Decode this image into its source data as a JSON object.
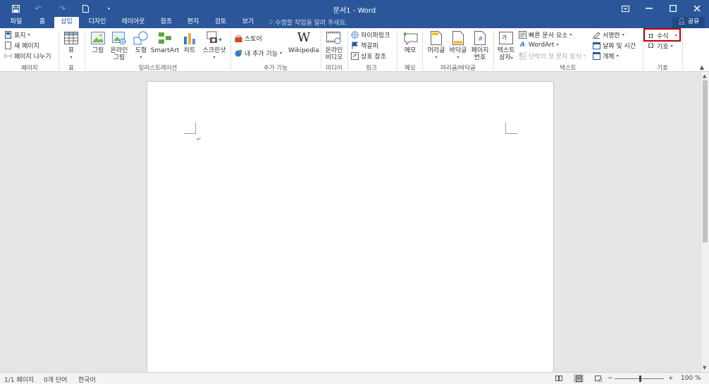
{
  "titlebar": {
    "title": "문서1 - Word",
    "qat": [
      {
        "name": "save-icon",
        "glyph": "💾"
      },
      {
        "name": "undo-icon",
        "glyph": "↶"
      },
      {
        "name": "redo-icon",
        "glyph": "↷"
      },
      {
        "name": "new-document-icon",
        "glyph": "🗋"
      },
      {
        "name": "customize-qat-icon",
        "glyph": "▾"
      }
    ],
    "controls": {
      "ribbon_options": "▭",
      "minimize": "—",
      "maximize": "☐",
      "close": "✕"
    }
  },
  "tabs": [
    {
      "label": "파일"
    },
    {
      "label": "홈"
    },
    {
      "label": "삽입"
    },
    {
      "label": "디자인"
    },
    {
      "label": "레이아웃"
    },
    {
      "label": "참조"
    },
    {
      "label": "편지"
    },
    {
      "label": "검토"
    },
    {
      "label": "보기"
    }
  ],
  "active_tab": "삽입",
  "tell_me": "수행할 작업을 알려 주세요.",
  "share_label": "공유",
  "ribbon": {
    "pages": {
      "label": "페이지",
      "cover": "표지",
      "blank": "새 페이지",
      "break": "페이지 나누기"
    },
    "table": {
      "label": "표",
      "button": "표"
    },
    "illustrations": {
      "label": "일러스트레이션",
      "picture": "그림",
      "online_picture": [
        "온라인",
        "그림"
      ],
      "shapes": "도형",
      "smartart": "SmartArt",
      "chart": "차트",
      "screenshot": "스크린샷"
    },
    "addins": {
      "label": "추가 기능",
      "store": "스토어",
      "my_addins": "내 추가 기능",
      "wikipedia": "Wikipedia"
    },
    "media": {
      "label": "미디어",
      "online_video": [
        "온라인",
        "비디오"
      ]
    },
    "links": {
      "label": "링크",
      "hyperlink": "하이퍼링크",
      "bookmark": "책갈피",
      "cross_ref": "상호 참조"
    },
    "comments": {
      "label": "메모",
      "comment": "메모"
    },
    "header_footer": {
      "label": "머리글/바닥글",
      "header": "머리글",
      "footer": "바닥글",
      "page_number": [
        "페이지",
        "번호"
      ]
    },
    "text": {
      "label": "텍스트",
      "textbox": [
        "텍스트",
        "상자"
      ],
      "quick_parts": "빠른 문서 요소",
      "wordart": "WordArt",
      "dropcap": "단락의 첫 문자 장식",
      "signature": "서명란",
      "datetime": "날짜 및 시간",
      "object": "개체"
    },
    "symbols": {
      "label": "기호",
      "equation": "수식",
      "symbol": "기호"
    }
  },
  "statusbar": {
    "page": "1/1 페이지",
    "words": "0개 단어",
    "language": "한국어",
    "zoom": "100 %",
    "zoom_minus": "−",
    "zoom_plus": "+"
  },
  "colors": {
    "accent": "#2b579a",
    "highlight": "#c00000"
  }
}
